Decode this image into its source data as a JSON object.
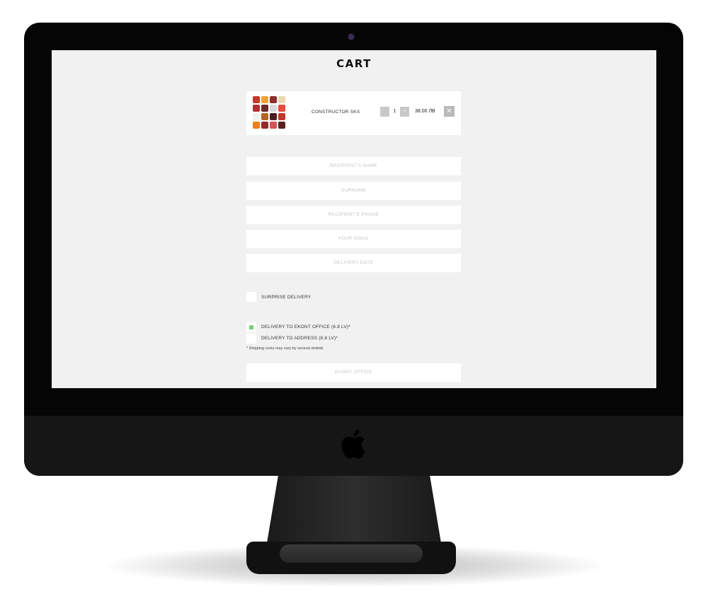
{
  "page": {
    "title": "CART"
  },
  "cart": {
    "item_name": "CONSTRUCTOR SKS",
    "quantity": "1",
    "qty_plus": "+",
    "price": "38.00 ЛВ",
    "remove_icon": "✕"
  },
  "form": {
    "recipient_name_placeholder": "RECIPIENT'S NAME",
    "surname_placeholder": "SURNAME",
    "recipient_phone_placeholder": "RECIPIENT'S PHONE",
    "email_placeholder": "YOUR EMAIL",
    "delivery_date_placeholder": "DELIVERY DATE",
    "surprise_label": "SURPRISE DELIVERY",
    "delivery_office_label": "DELIVERY TO EKONT OFFICE (6.8 LV)*",
    "delivery_address_label": "DELIVERY TO ADDRESS (8.8 LV)*",
    "shipping_note": "* Shipping costs may vary by several stotinki",
    "office_placeholder": "EKONT OFFICE"
  },
  "state": {
    "delivery_office_selected": true,
    "delivery_address_selected": false,
    "surprise_selected": false
  },
  "colors": {
    "screen_bg": "#f1f1f1",
    "selected_dot": "#7bd07b",
    "thumb_tiles": [
      "#c0392b",
      "#e8a33d",
      "#8e2e2e",
      "#e9d7b0",
      "#a83232",
      "#6b2a2a",
      "#d9d9d9",
      "#e74c3c",
      "#f0f0f0",
      "#b5651d",
      "#4a1f1f",
      "#c0392b",
      "#e67e22",
      "#8e2e2e",
      "#d35454",
      "#5a2020"
    ]
  }
}
